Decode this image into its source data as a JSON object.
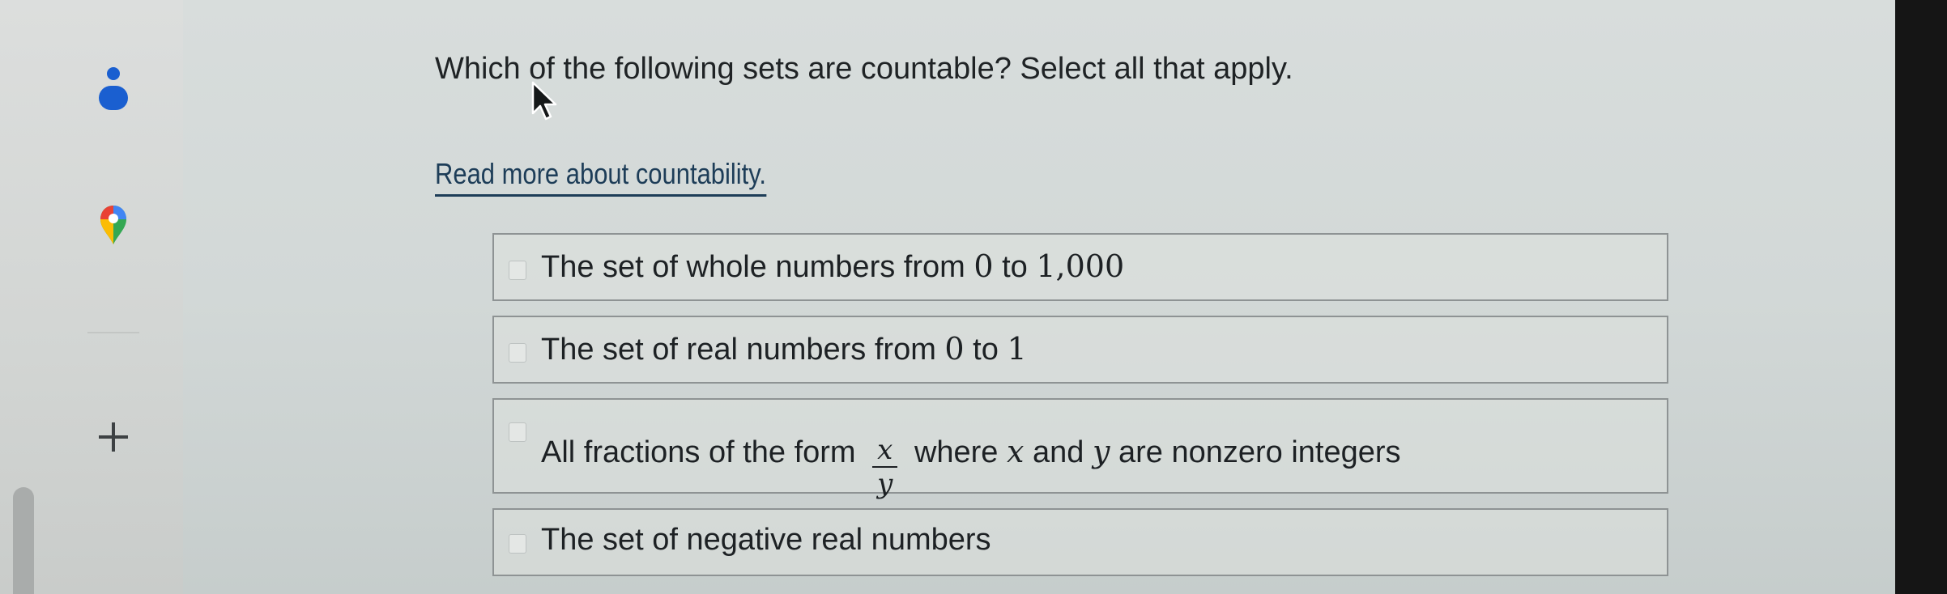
{
  "sidebar": {
    "icons": [
      "person-icon",
      "maps-pin-icon",
      "add-icon"
    ],
    "colors": {
      "person": "#1a5fd0",
      "pin_red": "#e94235",
      "pin_green": "#34a853",
      "pin_yellow": "#fbbc04",
      "pin_blue": "#4285f4"
    }
  },
  "question": {
    "text": "Which of the following sets are countable? Select all that apply."
  },
  "link": {
    "text": "Read more about countability."
  },
  "options": [
    {
      "checked": false,
      "text_1": "The set of whole numbers from",
      "math_a": "0",
      "text_2": "to",
      "math_b": "1,000"
    },
    {
      "checked": false,
      "text_1": "The set of real numbers from",
      "math_a": "0",
      "text_2": "to",
      "math_b": "1"
    },
    {
      "checked": false,
      "text_1": "All fractions of the form",
      "frac_num": "x",
      "frac_den": "y",
      "text_2": "where",
      "var_a": "x",
      "text_3": "and",
      "var_b": "y",
      "text_4": "are nonzero integers"
    },
    {
      "checked": false,
      "text_1": "The set of negative real numbers"
    }
  ],
  "colors": {
    "link": "#1d3d58",
    "text": "#1d2124",
    "option_border": "#8e9394"
  }
}
